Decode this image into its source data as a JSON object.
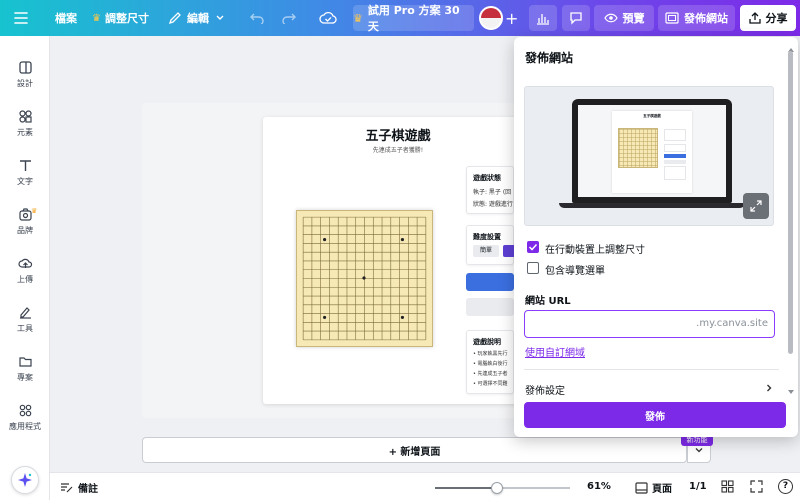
{
  "topbar": {
    "file": "檔案",
    "resize": "調整尺寸",
    "edit": "編輯",
    "trial": "試用 Pro 方案 30 天",
    "preview": "預覽",
    "publish_site": "發佈網站",
    "share": "分享"
  },
  "sidebar": {
    "items": [
      {
        "label": "設計",
        "icon": "layout-icon"
      },
      {
        "label": "元素",
        "icon": "shapes-icon"
      },
      {
        "label": "文字",
        "icon": "text-icon"
      },
      {
        "label": "品牌",
        "icon": "brand-icon"
      },
      {
        "label": "上傳",
        "icon": "upload-icon"
      },
      {
        "label": "工具",
        "icon": "draw-icon"
      },
      {
        "label": "專案",
        "icon": "folder-icon"
      },
      {
        "label": "應用程式",
        "icon": "apps-icon"
      }
    ]
  },
  "design": {
    "title": "五子棋遊戲",
    "subtitle": "先連成五子者獲勝!",
    "status_title": "遊戲狀態",
    "status_line1": "執子: 黑子 (回",
    "status_line2": "狀態: 遊戲進行",
    "difficulty_title": "難度設置",
    "difficulty_easy": "簡單",
    "rules_title": "遊戲說明",
    "rules": [
      "玩家執黑先行",
      "電腦執白後行",
      "先連成五子者",
      "可選擇不同難"
    ]
  },
  "canvas": {
    "add_page": "+ 新增頁面",
    "new_badge": "新功能"
  },
  "publish": {
    "title": "發佈網站",
    "resize_mobile": "在行動裝置上調整尺寸",
    "include_nav": "包含導覽選單",
    "url_label": "網站 URL",
    "url_suffix": ".my.canva.site",
    "custom_domain": "使用自訂網域",
    "settings": "發佈設定",
    "publish_button": "發佈",
    "preview_title": "五子棋遊戲"
  },
  "bottombar": {
    "notes": "備註",
    "zoom": "61%",
    "pages": "頁面",
    "page_count": "1/1",
    "help": "?"
  },
  "zoom_fraction": 0.61,
  "colors": {
    "accent": "#7d2ae8",
    "board": "#f7e9b5",
    "blue": "#3b6fe0"
  }
}
